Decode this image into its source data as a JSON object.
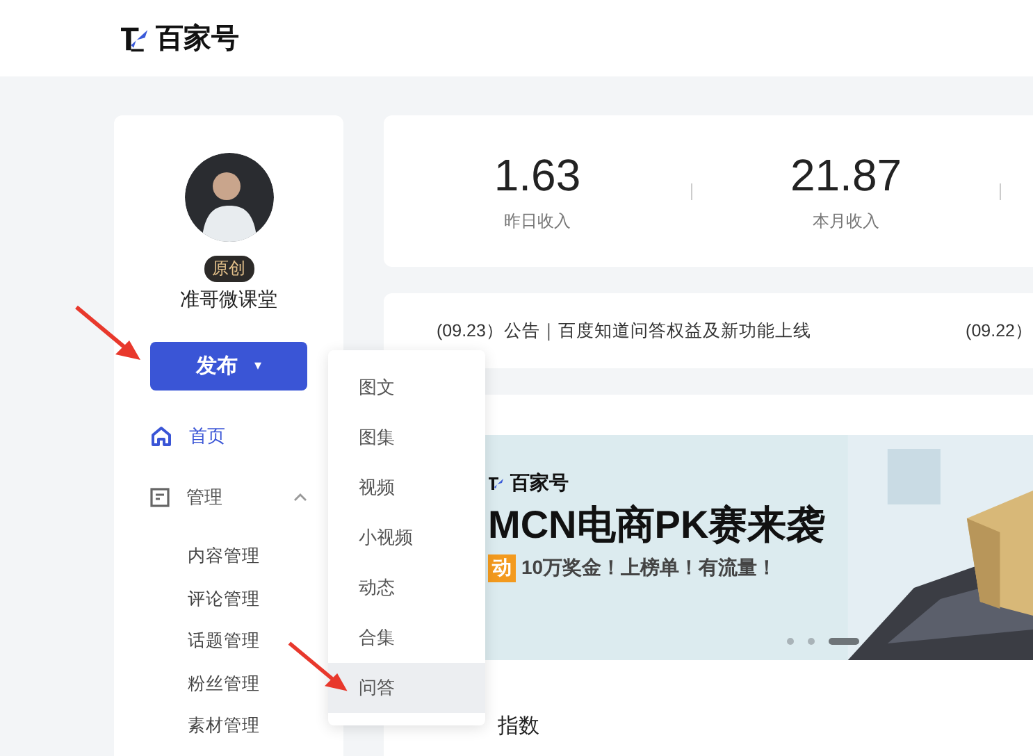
{
  "header": {
    "logo_text": "百家号"
  },
  "profile": {
    "badge": "原创",
    "name": "准哥微课堂"
  },
  "publish_button": {
    "label": "发布",
    "caret": "▾"
  },
  "nav": [
    {
      "kind": "link",
      "label": "首页",
      "selected": true
    },
    {
      "kind": "group",
      "label": "管理",
      "expanded": true,
      "children": [
        {
          "label": "内容管理"
        },
        {
          "label": "评论管理"
        },
        {
          "label": "话题管理"
        },
        {
          "label": "粉丝管理"
        },
        {
          "label": "素材管理"
        }
      ]
    }
  ],
  "publish_menu": [
    {
      "label": "图文",
      "hovered": false
    },
    {
      "label": "图集",
      "hovered": false
    },
    {
      "label": "视频",
      "hovered": false
    },
    {
      "label": "小视频",
      "hovered": false
    },
    {
      "label": "动态",
      "hovered": false
    },
    {
      "label": "合集",
      "hovered": false
    },
    {
      "label": "问答",
      "hovered": true
    }
  ],
  "stats": [
    {
      "value": "1.63",
      "label": "昨日收入"
    },
    {
      "value": "21.87",
      "label": "本月收入"
    }
  ],
  "notices": [
    "(09.23）公告｜百度知道问答权益及新功能上线",
    "(09.22）"
  ],
  "banner": {
    "logo_text": "百家号",
    "title": "MCN电商PK赛来袭",
    "tag": "动",
    "subtitle": "10万奖金！上榜单！有流量！",
    "dots": [
      {
        "selected": false
      },
      {
        "selected": false
      },
      {
        "selected": true
      }
    ]
  },
  "section_title": "指数"
}
